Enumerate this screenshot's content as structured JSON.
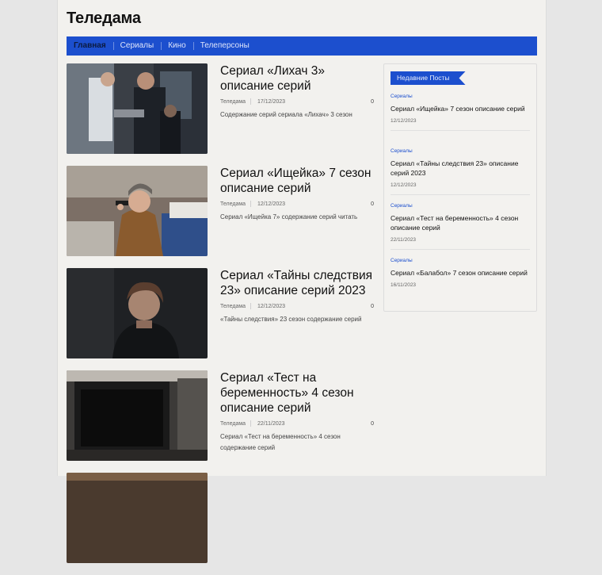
{
  "site": {
    "title": "Теледама"
  },
  "nav": {
    "items": [
      {
        "label": "Главная",
        "active": true
      },
      {
        "label": "Сериалы",
        "active": false
      },
      {
        "label": "Кино",
        "active": false
      },
      {
        "label": "Телеперсоны",
        "active": false
      }
    ]
  },
  "posts": [
    {
      "title": "Сериал «Лихач 3» описание серий",
      "author": "Теледама",
      "date": "17/12/2023",
      "comments": "0",
      "excerpt": "Содержание серий сериала «Лихач» 3 сезон"
    },
    {
      "title": "Сериал «Ищейка» 7 сезон описание серий",
      "author": "Теледама",
      "date": "12/12/2023",
      "comments": "0",
      "excerpt": "Сериал «Ищейка 7» содержание серий читать"
    },
    {
      "title": "Сериал «Тайны следствия 23» описание серий 2023",
      "author": "Теледама",
      "date": "12/12/2023",
      "comments": "0",
      "excerpt": "«Тайны следствия» 23 сезон содержание серий"
    },
    {
      "title": "Сериал «Тест на беременность» 4 сезон описание серий",
      "author": "Теледама",
      "date": "22/11/2023",
      "comments": "0",
      "excerpt": "Сериал «Тест на беременность» 4 сезон содержание серий"
    }
  ],
  "sidebar": {
    "heading": "Недавние Посты",
    "items": [
      {
        "category": "Сериалы",
        "title": "Сериал «Ищейка» 7 сезон описание серий",
        "date": "12/12/2023"
      },
      {
        "category": "Сериалы",
        "title": "Сериал «Тайны следствия 23» описание серий 2023",
        "date": "12/12/2023"
      },
      {
        "category": "Сериалы",
        "title": "Сериал «Тест на беременность» 4 сезон описание серий",
        "date": "22/11/2023"
      },
      {
        "category": "Сериалы",
        "title": "Сериал «Балабол» 7 сезон описание серий",
        "date": "16/11/2023"
      }
    ]
  },
  "colors": {
    "accent": "#1c4fce",
    "page_bg": "#f2f1ee"
  }
}
